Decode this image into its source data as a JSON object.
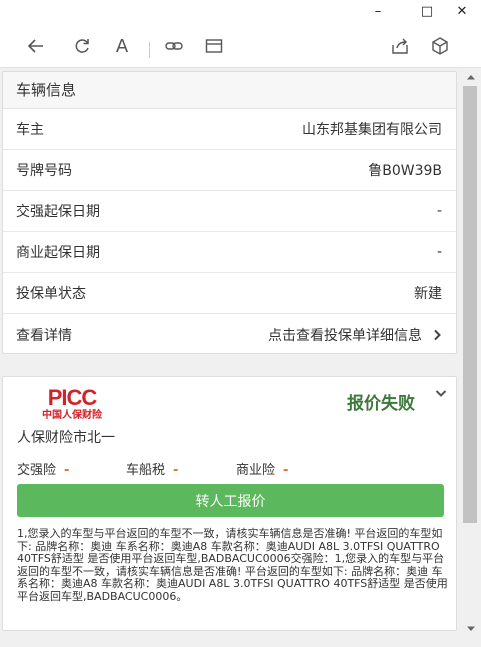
{
  "window": {
    "minimize_glyph": "–",
    "maximize_glyph": "□",
    "close_glyph": "✕"
  },
  "toolbar": {
    "back_icon": "arrow-left-icon",
    "refresh_icon": "refresh-icon",
    "font_label": "A",
    "link_icon": "link-icon",
    "card_icon": "card-icon",
    "share_icon": "share-icon",
    "package_icon": "package-icon"
  },
  "vehicle": {
    "title": "车辆信息",
    "rows": [
      {
        "label": "车主",
        "value": "山东邦基集团有限公司"
      },
      {
        "label": "号牌号码",
        "value": "鲁B0W39B"
      },
      {
        "label": "交强起保日期",
        "value": "-"
      },
      {
        "label": "商业起保日期",
        "value": "-"
      },
      {
        "label": "投保单状态",
        "value": "新建"
      },
      {
        "label": "查看详情",
        "value": "点击查看投保单详细信息"
      }
    ]
  },
  "quote": {
    "logo_text": "PICC",
    "logo_sub": "中国人保财险",
    "company": "人保财险市北一",
    "status": "报价失败",
    "taxes": [
      {
        "label": "交强险",
        "value": "-"
      },
      {
        "label": "车船税",
        "value": "-"
      },
      {
        "label": "商业险",
        "value": "-"
      }
    ],
    "button_label": "转人工报价",
    "message": "1,您录入的车型与平台返回的车型不一致，请核实车辆信息是否准确! 平台返回的车型如下: 品牌名称：奥迪 车系名称：奥迪A8 车款名称：奥迪AUDI A8L 3.0TFSI QUATTRO 40TFS舒适型 是否使用平台返回车型,BADBACUC0006交强险：1,您录入的车型与平台返回的车型不一致，请核实车辆信息是否准确! 平台返回的车型如下: 品牌名称：奥迪 车系名称：奥迪A8 车款名称：奥迪AUDI A8L 3.0TFSI QUATTRO 40TFS舒适型 是否使用平台返回车型,BADBACUC0006。"
  },
  "colors": {
    "status": "#3c7a3c",
    "button": "#5cb85c",
    "picc_red": "#d2232a"
  }
}
